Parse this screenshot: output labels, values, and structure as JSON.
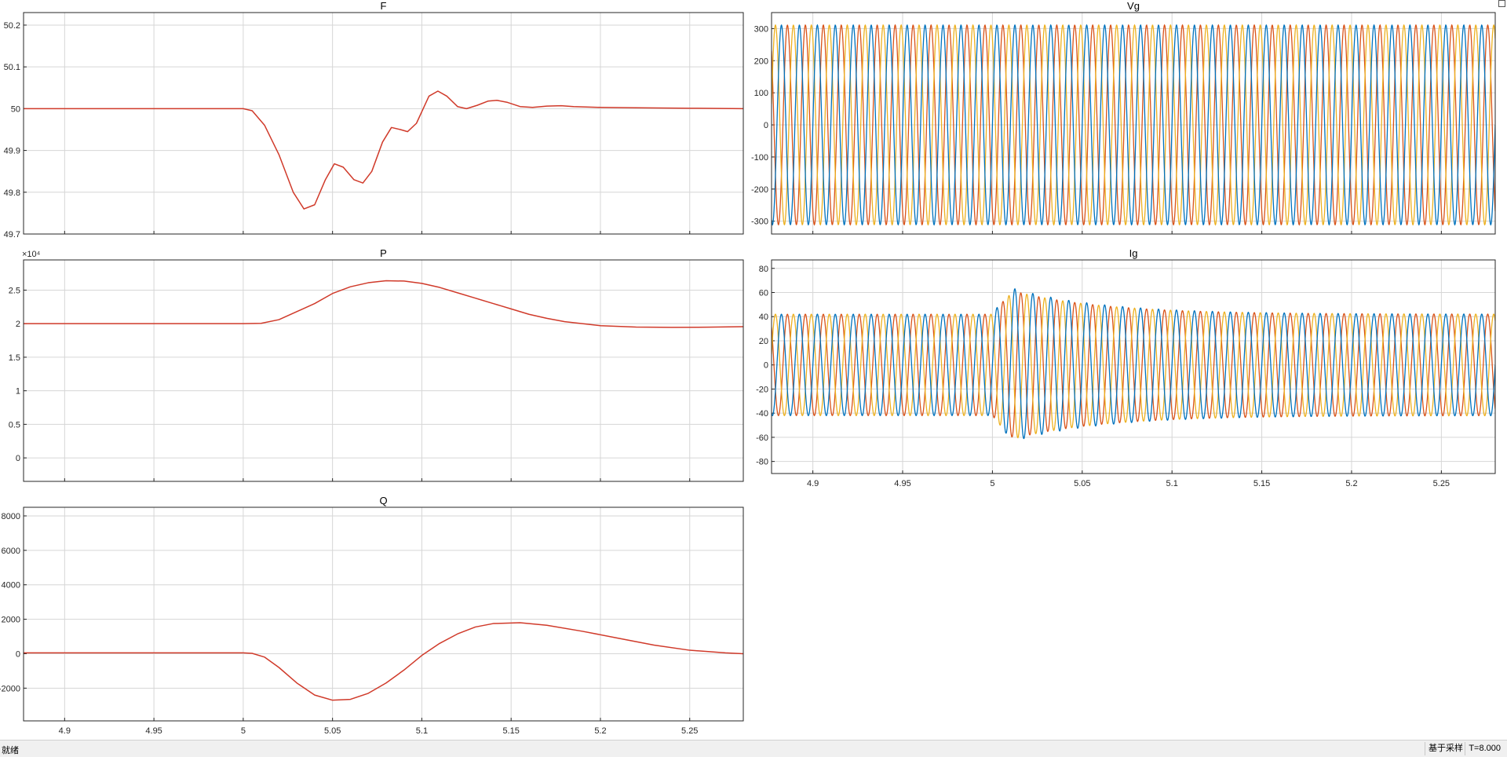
{
  "status": {
    "left": "就绪",
    "mode": "基于采样",
    "time": "T=8.000"
  },
  "colors": {
    "grid": "#d6d6d6",
    "axis": "#262626",
    "blue": "#0072bd",
    "orange": "#d95319",
    "yellow": "#edb120",
    "red": "#d03a2a"
  },
  "chart_data": [
    {
      "type": "line",
      "title": "F",
      "xlim": [
        4.877,
        5.28
      ],
      "ylim": [
        49.7,
        50.23
      ],
      "yticks": [
        49.7,
        49.8,
        49.9,
        50,
        50.1,
        50.2
      ],
      "ytick_labels": [
        "49.7",
        "49.8",
        "49.9",
        "50",
        "50.1",
        "50.2"
      ],
      "xticks": [
        4.9,
        4.95,
        5,
        5.05,
        5.1,
        5.15,
        5.2,
        5.25
      ],
      "xtick_labels": [],
      "exponent": "",
      "series": [
        {
          "color": "red",
          "points": [
            [
              4.877,
              50
            ],
            [
              5.0,
              50
            ],
            [
              5.005,
              49.995
            ],
            [
              5.012,
              49.96
            ],
            [
              5.02,
              49.89
            ],
            [
              5.028,
              49.8
            ],
            [
              5.034,
              49.76
            ],
            [
              5.04,
              49.77
            ],
            [
              5.046,
              49.83
            ],
            [
              5.051,
              49.868
            ],
            [
              5.056,
              49.86
            ],
            [
              5.062,
              49.83
            ],
            [
              5.067,
              49.822
            ],
            [
              5.072,
              49.85
            ],
            [
              5.078,
              49.92
            ],
            [
              5.083,
              49.955
            ],
            [
              5.088,
              49.95
            ],
            [
              5.092,
              49.945
            ],
            [
              5.097,
              49.965
            ],
            [
              5.104,
              50.03
            ],
            [
              5.109,
              50.042
            ],
            [
              5.114,
              50.03
            ],
            [
              5.12,
              50.005
            ],
            [
              5.125,
              50.0
            ],
            [
              5.131,
              50.008
            ],
            [
              5.137,
              50.018
            ],
            [
              5.142,
              50.02
            ],
            [
              5.148,
              50.015
            ],
            [
              5.155,
              50.005
            ],
            [
              5.162,
              50.003
            ],
            [
              5.17,
              50.006
            ],
            [
              5.178,
              50.007
            ],
            [
              5.185,
              50.005
            ],
            [
              5.2,
              50.003
            ],
            [
              5.22,
              50.002
            ],
            [
              5.25,
              50.001
            ],
            [
              5.28,
              50.0
            ]
          ]
        }
      ]
    },
    {
      "type": "line",
      "title": "P",
      "xlim": [
        4.877,
        5.28
      ],
      "ylim": [
        -3500,
        29500
      ],
      "yticks": [
        0,
        5000,
        10000,
        15000,
        20000,
        25000
      ],
      "ytick_labels": [
        "0",
        "0.5",
        "1",
        "1.5",
        "2",
        "2.5"
      ],
      "xticks": [
        4.9,
        4.95,
        5,
        5.05,
        5.1,
        5.15,
        5.2,
        5.25
      ],
      "xtick_labels": [],
      "exponent": "×10⁴",
      "series": [
        {
          "color": "red",
          "points": [
            [
              4.877,
              20000
            ],
            [
              5.0,
              20000
            ],
            [
              5.01,
              20050
            ],
            [
              5.02,
              20600
            ],
            [
              5.03,
              21800
            ],
            [
              5.04,
              23000
            ],
            [
              5.05,
              24500
            ],
            [
              5.06,
              25500
            ],
            [
              5.07,
              26100
            ],
            [
              5.08,
              26400
            ],
            [
              5.09,
              26350
            ],
            [
              5.1,
              26000
            ],
            [
              5.11,
              25400
            ],
            [
              5.12,
              24600
            ],
            [
              5.13,
              23800
            ],
            [
              5.14,
              23000
            ],
            [
              5.15,
              22200
            ],
            [
              5.16,
              21400
            ],
            [
              5.17,
              20800
            ],
            [
              5.18,
              20300
            ],
            [
              5.2,
              19700
            ],
            [
              5.22,
              19500
            ],
            [
              5.24,
              19450
            ],
            [
              5.26,
              19480
            ],
            [
              5.28,
              19550
            ]
          ]
        }
      ]
    },
    {
      "type": "line",
      "title": "Q",
      "xlim": [
        4.877,
        5.28
      ],
      "ylim": [
        -3900,
        8500
      ],
      "yticks": [
        -2000,
        0,
        2000,
        4000,
        6000,
        8000
      ],
      "ytick_labels": [
        "-2000",
        "0",
        "2000",
        "4000",
        "6000",
        "8000"
      ],
      "xticks": [
        4.9,
        4.95,
        5,
        5.05,
        5.1,
        5.15,
        5.2,
        5.25
      ],
      "xtick_labels": [
        "4.9",
        "4.95",
        "5",
        "5.05",
        "5.1",
        "5.15",
        "5.2",
        "5.25"
      ],
      "exponent": "",
      "series": [
        {
          "color": "red",
          "points": [
            [
              4.877,
              50
            ],
            [
              5.0,
              50
            ],
            [
              5.005,
              20
            ],
            [
              5.012,
              -200
            ],
            [
              5.02,
              -800
            ],
            [
              5.03,
              -1700
            ],
            [
              5.04,
              -2400
            ],
            [
              5.05,
              -2700
            ],
            [
              5.06,
              -2650
            ],
            [
              5.07,
              -2300
            ],
            [
              5.08,
              -1700
            ],
            [
              5.09,
              -950
            ],
            [
              5.1,
              -100
            ],
            [
              5.11,
              600
            ],
            [
              5.12,
              1150
            ],
            [
              5.13,
              1550
            ],
            [
              5.14,
              1750
            ],
            [
              5.155,
              1800
            ],
            [
              5.17,
              1650
            ],
            [
              5.19,
              1300
            ],
            [
              5.21,
              900
            ],
            [
              5.23,
              500
            ],
            [
              5.25,
              200
            ],
            [
              5.27,
              50
            ],
            [
              5.28,
              0
            ]
          ]
        }
      ]
    },
    {
      "type": "line",
      "title": "Vg",
      "xlim": [
        4.877,
        5.28
      ],
      "ylim": [
        -340,
        350
      ],
      "yticks": [
        -300,
        -200,
        -100,
        0,
        100,
        200,
        300
      ],
      "ytick_labels": [
        "-300",
        "-200",
        "-100",
        "0",
        "100",
        "200",
        "300"
      ],
      "xticks": [
        4.9,
        4.95,
        5,
        5.05,
        5.1,
        5.15,
        5.2,
        5.25
      ],
      "xtick_labels": [],
      "exponent": "",
      "sine": {
        "frequency": 100,
        "amplitude": 311,
        "phase_deg": [
          0,
          -120,
          120
        ],
        "colors": [
          "blue",
          "orange",
          "yellow"
        ]
      }
    },
    {
      "type": "line",
      "title": "Ig",
      "xlim": [
        4.877,
        5.28
      ],
      "ylim": [
        -90,
        87
      ],
      "yticks": [
        -80,
        -60,
        -40,
        -20,
        0,
        20,
        40,
        60,
        80
      ],
      "ytick_labels": [
        "-80",
        "-60",
        "-40",
        "-20",
        "0",
        "20",
        "40",
        "60",
        "80"
      ],
      "xticks": [
        4.9,
        4.95,
        5,
        5.05,
        5.1,
        5.15,
        5.2,
        5.25
      ],
      "xtick_labels": [
        "4.9",
        "4.95",
        "5",
        "5.05",
        "5.1",
        "5.15",
        "5.2",
        "5.25"
      ],
      "exponent": "",
      "sine": {
        "frequency": 100,
        "amplitude": 42,
        "phase_deg": [
          0,
          -120,
          120
        ],
        "colors": [
          "blue",
          "orange",
          "yellow"
        ],
        "transient": {
          "start": 5.0,
          "peak_at": 5.012,
          "peak_extra": 27,
          "decay": 0.05,
          "offset_extra": -12
        }
      }
    }
  ]
}
